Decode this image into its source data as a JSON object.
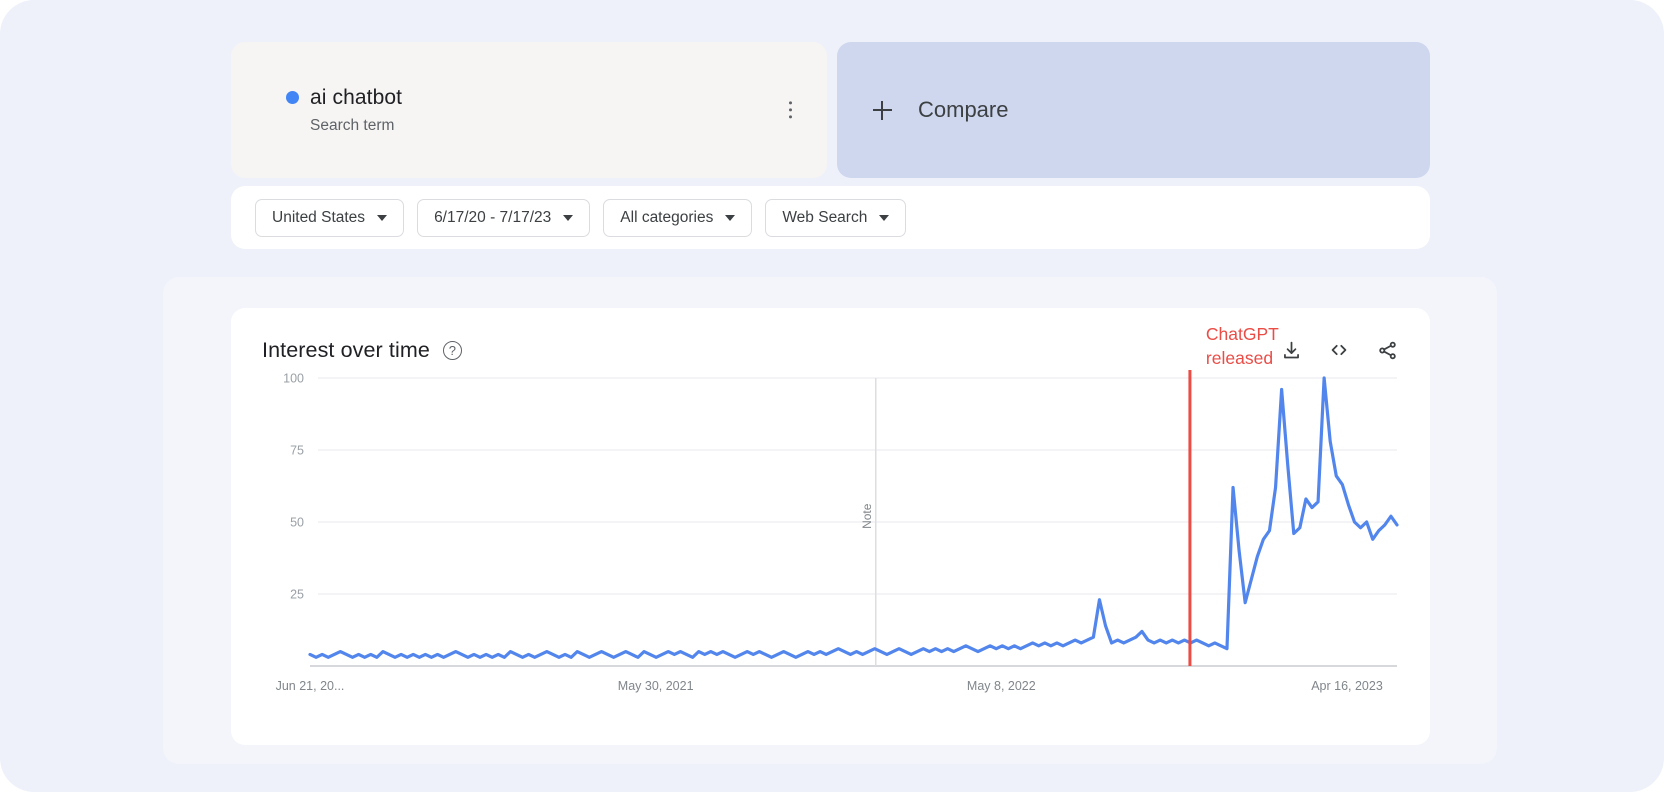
{
  "search_term": {
    "name": "ai chatbot",
    "subtitle": "Search term",
    "dot_color": "#4285f4",
    "menu_icon": "kebab-menu-icon"
  },
  "compare": {
    "label": "Compare",
    "plus_icon": "plus-icon"
  },
  "filters": [
    {
      "label": "United States",
      "name": "location-filter"
    },
    {
      "label": "6/17/20 - 7/17/23",
      "name": "date-range-filter"
    },
    {
      "label": "All categories",
      "name": "category-filter"
    },
    {
      "label": "Web Search",
      "name": "search-type-filter"
    }
  ],
  "chart_panel": {
    "title": "Interest over time",
    "help_icon": "question-mark-icon",
    "help_glyph": "?",
    "actions": [
      {
        "name": "download-csv-button",
        "icon": "download-icon"
      },
      {
        "name": "embed-button",
        "icon": "code-embed-icon"
      },
      {
        "name": "share-button",
        "icon": "share-icon"
      }
    ]
  },
  "chart_data": {
    "type": "line",
    "title": "Interest over time",
    "xlabel": "",
    "ylabel": "",
    "ylim": [
      0,
      100
    ],
    "yticks": [
      25,
      50,
      75,
      100
    ],
    "grid": true,
    "legend_position": "none",
    "line_color": "#5286ed",
    "xtick_labels": [
      "Jun 21, 20...",
      "May 30, 2021",
      "May 8, 2022",
      "Apr 16, 2023"
    ],
    "xtick_positions": [
      0,
      0.318,
      0.636,
      0.954
    ],
    "annotations": [
      {
        "name": "chatgpt-release-marker",
        "text_line1": "ChatGPT",
        "text_line2": "released",
        "color": "#ea4c46",
        "x_fraction": 0.8095
      },
      {
        "name": "note-marker",
        "text": "Note",
        "color": "#80868b",
        "x_fraction": 0.5205
      }
    ],
    "series": [
      {
        "name": "ai chatbot",
        "color": "#5286ed",
        "values": [
          4,
          3,
          4,
          3,
          4,
          5,
          4,
          3,
          4,
          3,
          4,
          3,
          5,
          4,
          3,
          4,
          3,
          4,
          3,
          4,
          3,
          4,
          3,
          4,
          5,
          4,
          3,
          4,
          3,
          4,
          3,
          4,
          3,
          5,
          4,
          3,
          4,
          3,
          4,
          5,
          4,
          3,
          4,
          3,
          5,
          4,
          3,
          4,
          5,
          4,
          3,
          4,
          5,
          4,
          3,
          5,
          4,
          3,
          4,
          5,
          4,
          5,
          4,
          3,
          5,
          4,
          5,
          4,
          5,
          4,
          3,
          4,
          5,
          4,
          5,
          4,
          3,
          4,
          5,
          4,
          3,
          4,
          5,
          4,
          5,
          4,
          5,
          6,
          5,
          4,
          5,
          4,
          5,
          6,
          5,
          4,
          5,
          6,
          5,
          4,
          5,
          6,
          5,
          6,
          5,
          6,
          5,
          6,
          7,
          6,
          5,
          6,
          7,
          6,
          7,
          6,
          7,
          6,
          7,
          8,
          7,
          8,
          7,
          8,
          7,
          8,
          9,
          8,
          9,
          10,
          23,
          14,
          8,
          9,
          8,
          9,
          10,
          12,
          9,
          8,
          9,
          8,
          9,
          8,
          9,
          8,
          9,
          8,
          7,
          8,
          7,
          6,
          62,
          40,
          22,
          30,
          38,
          44,
          47,
          62,
          96,
          70,
          46,
          48,
          58,
          55,
          57,
          100,
          78,
          66,
          63,
          56,
          50,
          48,
          50,
          44,
          47,
          49,
          52,
          49
        ]
      }
    ]
  }
}
